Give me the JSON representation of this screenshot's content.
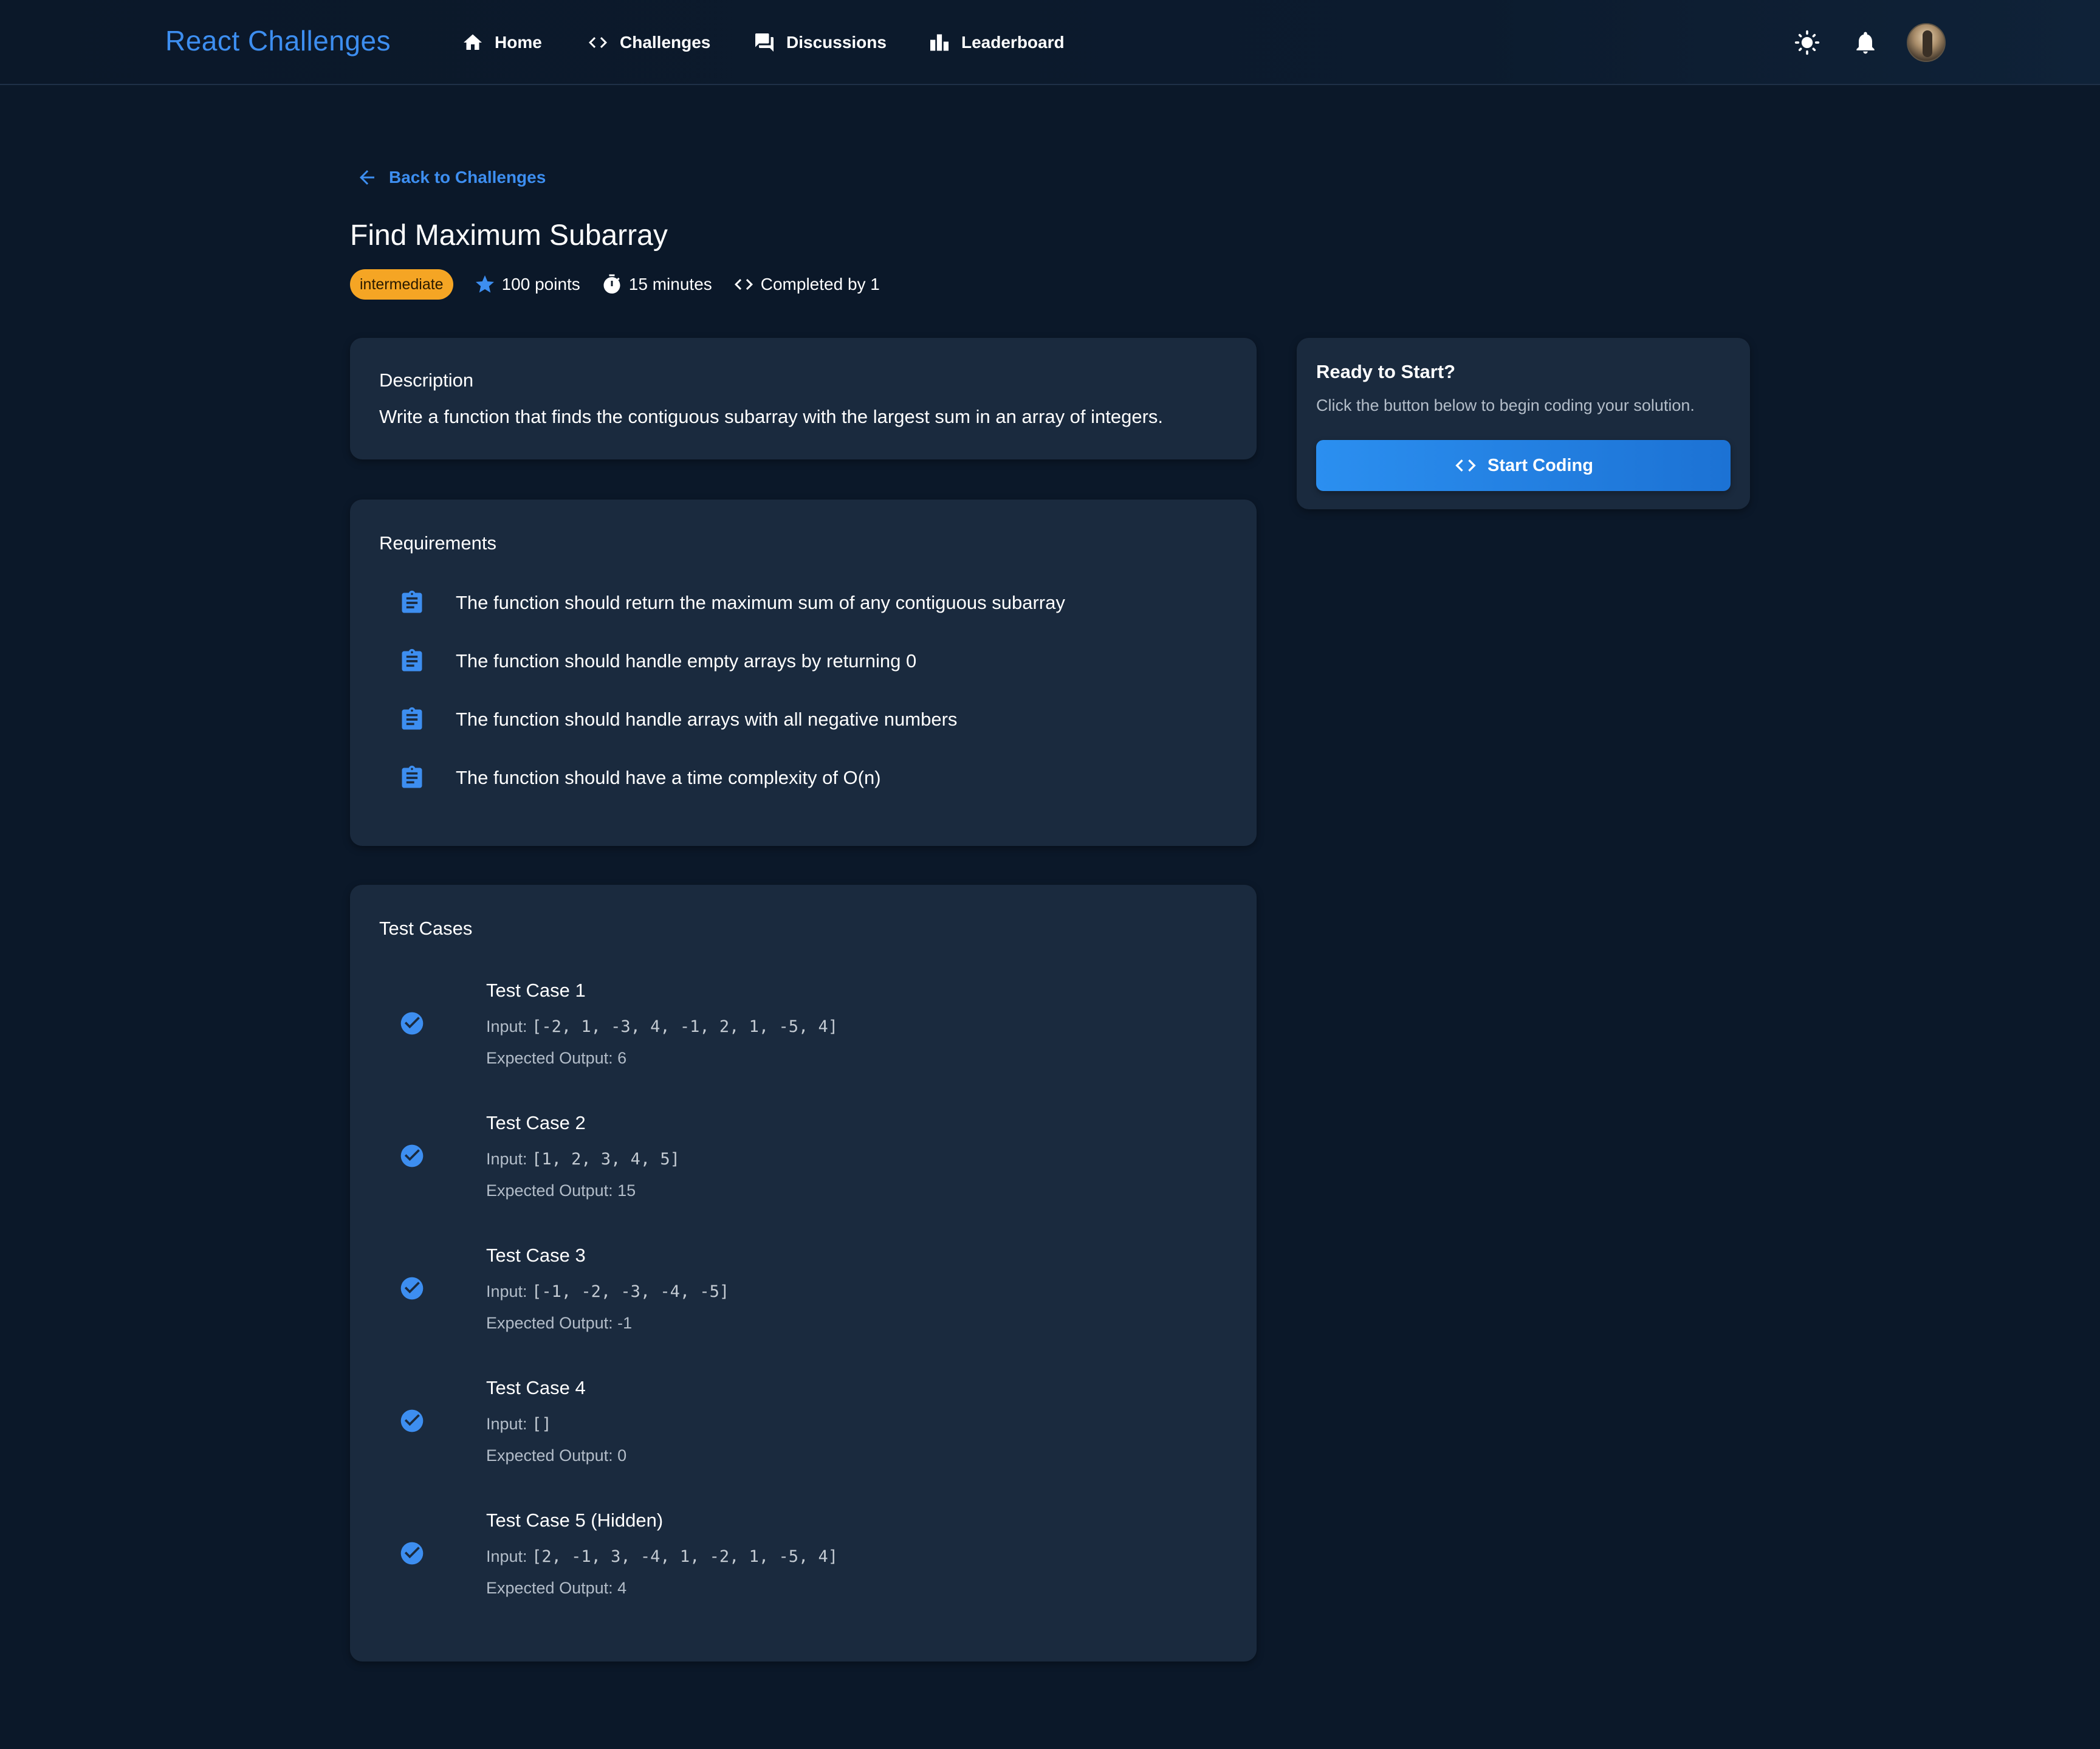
{
  "header": {
    "brand": "React Challenges",
    "nav": [
      {
        "label": "Home",
        "icon": "home-icon"
      },
      {
        "label": "Challenges",
        "icon": "code-icon"
      },
      {
        "label": "Discussions",
        "icon": "forum-icon"
      },
      {
        "label": "Leaderboard",
        "icon": "leaderboard-icon"
      }
    ],
    "actions": [
      "theme-toggle-icon",
      "notifications-icon",
      "avatar"
    ]
  },
  "back_link": "Back to Challenges",
  "challenge": {
    "title": "Find Maximum Subarray",
    "difficulty": "intermediate",
    "points": "100 points",
    "duration": "15 minutes",
    "completed": "Completed by 1"
  },
  "description": {
    "heading": "Description",
    "text": "Write a function that finds the contiguous subarray with the largest sum in an array of integers."
  },
  "requirements": {
    "heading": "Requirements",
    "items": [
      "The function should return the maximum sum of any contiguous subarray",
      "The function should handle empty arrays by returning 0",
      "The function should handle arrays with all negative numbers",
      "The function should have a time complexity of O(n)"
    ]
  },
  "test_cases": {
    "heading": "Test Cases",
    "items": [
      {
        "title": "Test Case 1",
        "input_label": "Input: ",
        "input": "[-2, 1, -3, 4, -1, 2, 1, -5, 4]",
        "output": "Expected Output: 6"
      },
      {
        "title": "Test Case 2",
        "input_label": "Input: ",
        "input": "[1, 2, 3, 4, 5]",
        "output": "Expected Output: 15"
      },
      {
        "title": "Test Case 3",
        "input_label": "Input: ",
        "input": "[-1, -2, -3, -4, -5]",
        "output": "Expected Output: -1"
      },
      {
        "title": "Test Case 4",
        "input_label": "Input: ",
        "input": "[]",
        "output": "Expected Output: 0"
      },
      {
        "title": "Test Case 5 (Hidden)",
        "input_label": "Input: ",
        "input": "[2, -1, 3, -4, 1, -2, 1, -5, 4]",
        "output": "Expected Output: 4"
      }
    ]
  },
  "sidebar": {
    "title": "Ready to Start?",
    "text": "Click the button below to begin coding your solution.",
    "button": "Start Coding"
  },
  "colors": {
    "accent": "#3d8ef0",
    "background": "#0b1829",
    "card": "#1a2a3e",
    "badge": "#f5a524"
  }
}
